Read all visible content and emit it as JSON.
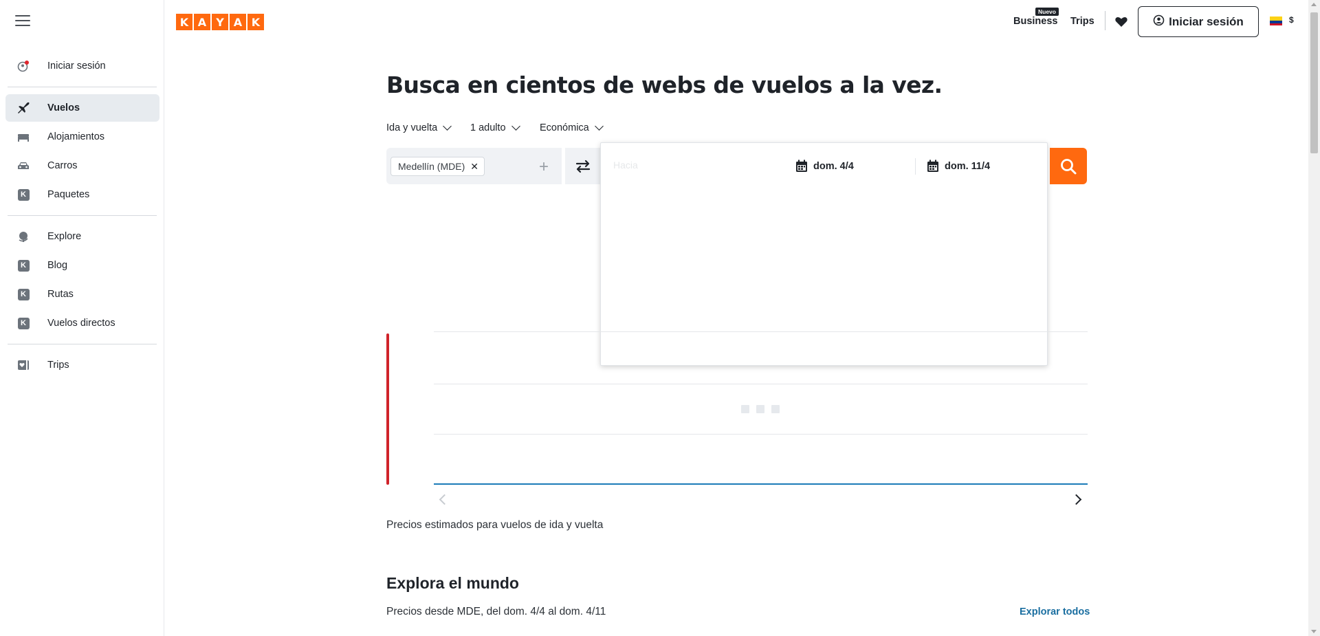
{
  "sidebar": {
    "items": [
      {
        "label": "Iniciar sesión"
      },
      {
        "label": "Vuelos"
      },
      {
        "label": "Alojamientos"
      },
      {
        "label": "Carros"
      },
      {
        "label": "Paquetes"
      },
      {
        "label": "Explore"
      },
      {
        "label": "Blog"
      },
      {
        "label": "Rutas"
      },
      {
        "label": "Vuelos directos"
      },
      {
        "label": "Trips"
      }
    ],
    "active": "Vuelos"
  },
  "header": {
    "logo_letters": [
      "K",
      "A",
      "Y",
      "A",
      "K"
    ],
    "business_label": "Business",
    "business_badge": "Nuevo",
    "trips_label": "Trips",
    "login_label": "Iniciar sesión",
    "currency": "$",
    "flag": "colombia-flag",
    "brand_color": "#ff690f"
  },
  "main": {
    "title": "Busca en cientos de webs de vuelos a la vez.",
    "options": {
      "trip_type": "Ida y vuelta",
      "passengers": "1 adulto",
      "cabin": "Económica"
    },
    "search": {
      "origin_chip": "Medellín (MDE)",
      "depart_date": "dom. 4/4",
      "return_date": "dom. 11/4"
    },
    "price_note": "Precios estimados para vuelos de ida y vuelta",
    "explore": {
      "title": "Explora el mundo",
      "subtitle": "Precios desde MDE, del dom. 4/4 al dom. 4/11",
      "link": "Explorar todos"
    }
  }
}
